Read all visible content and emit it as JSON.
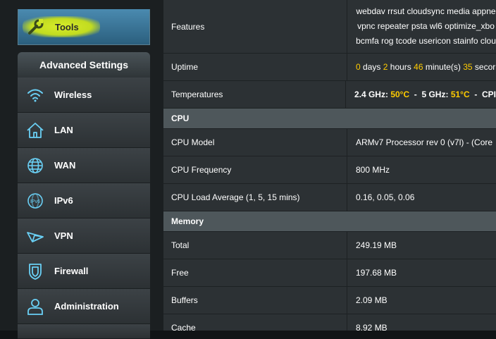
{
  "sidebar": {
    "tools_label": "Tools",
    "advanced_header": "Advanced Settings",
    "items": [
      {
        "label": "Wireless",
        "icon": "wifi-icon"
      },
      {
        "label": "LAN",
        "icon": "home-icon"
      },
      {
        "label": "WAN",
        "icon": "globe-icon"
      },
      {
        "label": "IPv6",
        "icon": "ipv6-icon"
      },
      {
        "label": "VPN",
        "icon": "vpn-icon"
      },
      {
        "label": "Firewall",
        "icon": "shield-icon"
      },
      {
        "label": "Administration",
        "icon": "user-icon"
      }
    ]
  },
  "info": {
    "features": {
      "label": "Features",
      "lines": [
        "webdav rrsut cloudsync media appne",
        "vpnc repeater psta wl6 optimize_xbo",
        "bcmfa rog tcode usericon stainfo clou"
      ]
    },
    "uptime": {
      "label": "Uptime",
      "days": "0",
      "days_unit": "days",
      "hours": "2",
      "hours_unit": "hours",
      "minutes": "46",
      "minutes_unit": "minute(s)",
      "seconds": "35",
      "seconds_unit": "secor"
    },
    "temperatures": {
      "label": "Temperatures",
      "band1": "2.4 GHz:",
      "temp1": "50°C",
      "sep": "-",
      "band2": "5 GHz:",
      "temp2": "51°C",
      "tail": "CPI"
    }
  },
  "cpu": {
    "header": "CPU",
    "model_label": "CPU Model",
    "model_value": "ARMv7 Processor rev 0 (v7l)  -  (Core",
    "freq_label": "CPU Frequency",
    "freq_value": "800 MHz",
    "load_label": "CPU Load Average (1, 5, 15 mins)",
    "load_value": "0.16,  0.05,  0.06"
  },
  "memory": {
    "header": "Memory",
    "total_label": "Total",
    "total_value": "249.19 MB",
    "free_label": "Free",
    "free_value": "197.68 MB",
    "buffers_label": "Buffers",
    "buffers_value": "2.09 MB",
    "cache_label": "Cache",
    "cache_value": "8.92 MB"
  },
  "colors": {
    "accent": "#ffcc00",
    "tools_highlight": "#d7ec2a",
    "icon_blue": "#6ad0f5"
  }
}
